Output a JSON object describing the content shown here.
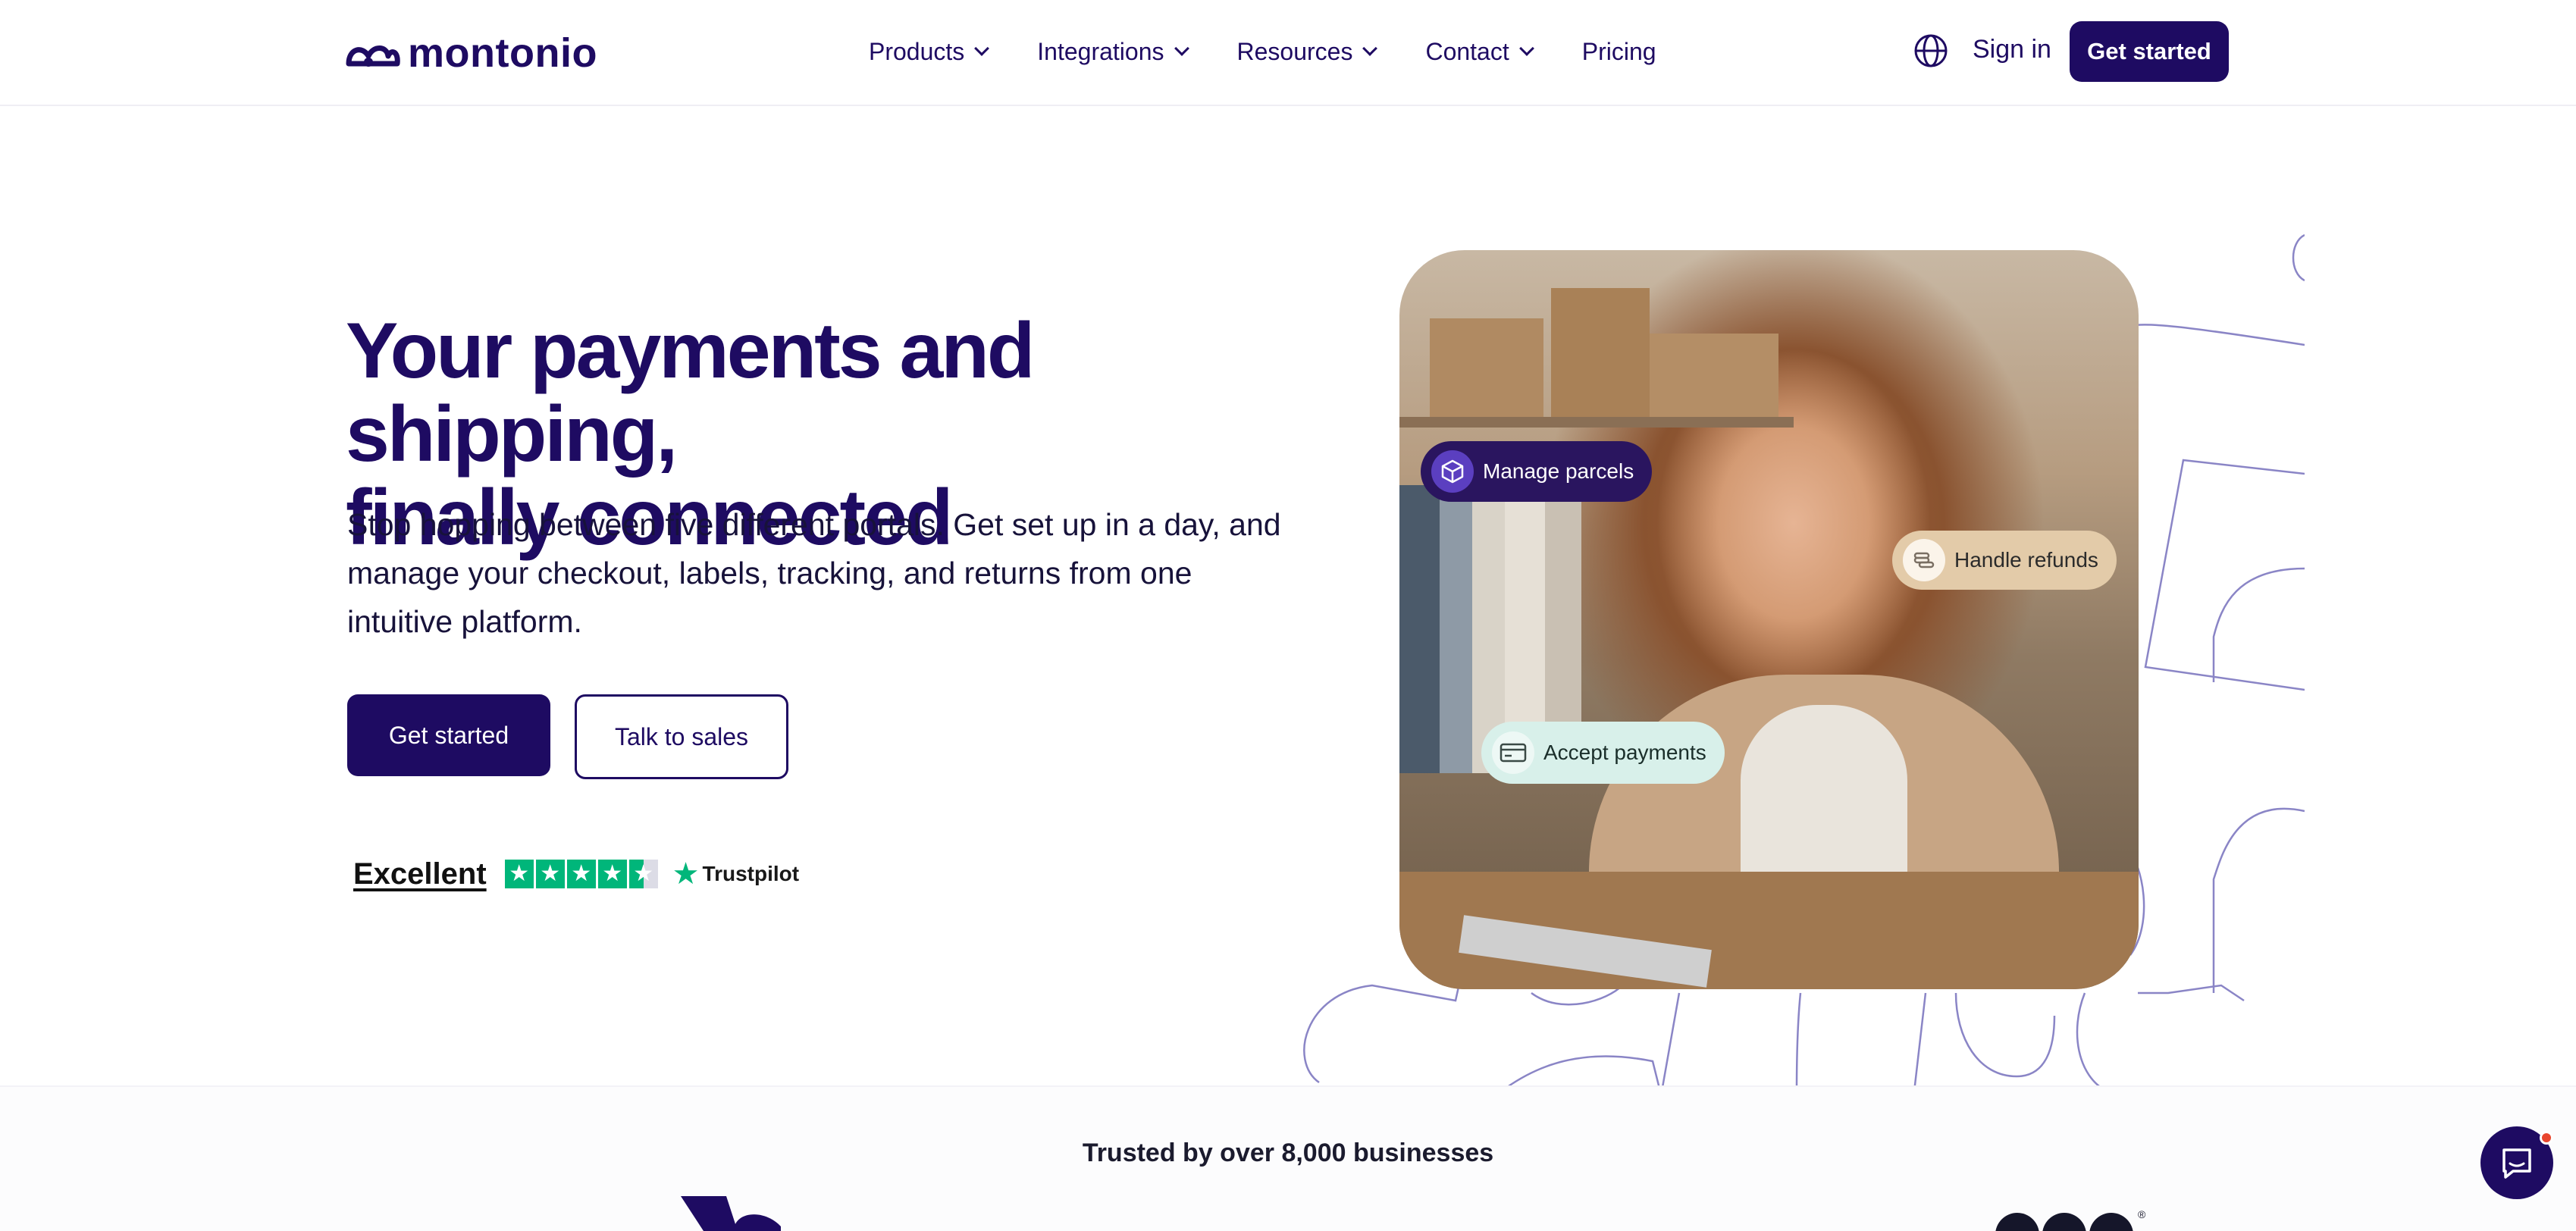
{
  "brand": {
    "name": "montonio"
  },
  "nav": {
    "items": [
      {
        "label": "Products",
        "dropdown": true
      },
      {
        "label": "Integrations",
        "dropdown": true
      },
      {
        "label": "Resources",
        "dropdown": true
      },
      {
        "label": "Contact",
        "dropdown": true
      },
      {
        "label": "Pricing",
        "dropdown": false
      }
    ],
    "language_icon": "globe-icon",
    "signin_label": "Sign in",
    "cta_label": "Get started"
  },
  "hero": {
    "title_line1": "Your payments and shipping,",
    "title_line2": "finally connected",
    "subtitle": "Stop hopping between five different portals. Get set up in a day, and manage your checkout, labels, tracking, and returns from one intuitive platform.",
    "primary_cta": "Get started",
    "secondary_cta": "Talk to sales",
    "rating": {
      "label": "Excellent",
      "stars": 4.5,
      "provider": "Trustpilot"
    },
    "badges": {
      "parcels": "Manage parcels",
      "refunds": "Handle refunds",
      "payments": "Accept payments"
    }
  },
  "trusted": {
    "text": "Trusted by over 8,000 businesses"
  },
  "colors": {
    "brand": "#1e0b62",
    "trustpilot_green": "#00b67a",
    "parcels_badge": "#2a155f",
    "refunds_badge": "#e3cba9",
    "payments_badge": "#d8f0ea"
  },
  "chat": {
    "icon": "chat-icon",
    "has_notification": true
  }
}
